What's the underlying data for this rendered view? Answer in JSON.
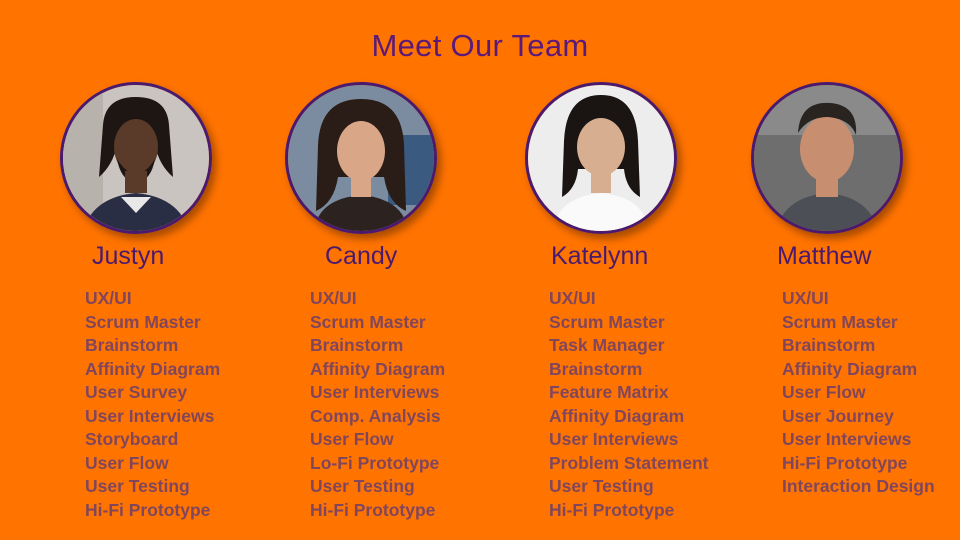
{
  "title": "Meet Our Team",
  "colors": {
    "background": "#FF7300",
    "title": "#5B1A7A",
    "name": "#4A1A6E",
    "role": "#5E3A75",
    "avatar_border": "#4A1A6E"
  },
  "members": [
    {
      "name": "Justyn",
      "roles": [
        "UX/UI",
        "Scrum Master",
        "Brainstorm",
        "Affinity Diagram",
        "User Survey",
        "User Interviews",
        "Storyboard",
        "User Flow",
        "User Testing",
        "Hi-Fi Prototype"
      ]
    },
    {
      "name": "Candy",
      "roles": [
        "UX/UI",
        "Scrum Master",
        "Brainstorm",
        "Affinity Diagram",
        "User Interviews",
        "Comp. Analysis",
        "User Flow",
        "Lo-Fi Prototype",
        "User Testing",
        "Hi-Fi Prototype"
      ]
    },
    {
      "name": "Katelynn",
      "roles": [
        "UX/UI",
        "Scrum Master",
        "Task Manager",
        "Brainstorm",
        "Feature Matrix",
        "Affinity Diagram",
        "User Interviews",
        "Problem Statement",
        "User Testing",
        "Hi-Fi Prototype"
      ]
    },
    {
      "name": "Matthew",
      "roles": [
        "UX/UI",
        "Scrum Master",
        "Brainstorm",
        "Affinity Diagram",
        "User Flow",
        "User Journey",
        "User Interviews",
        "Hi-Fi Prototype",
        "Interaction Design"
      ]
    }
  ]
}
